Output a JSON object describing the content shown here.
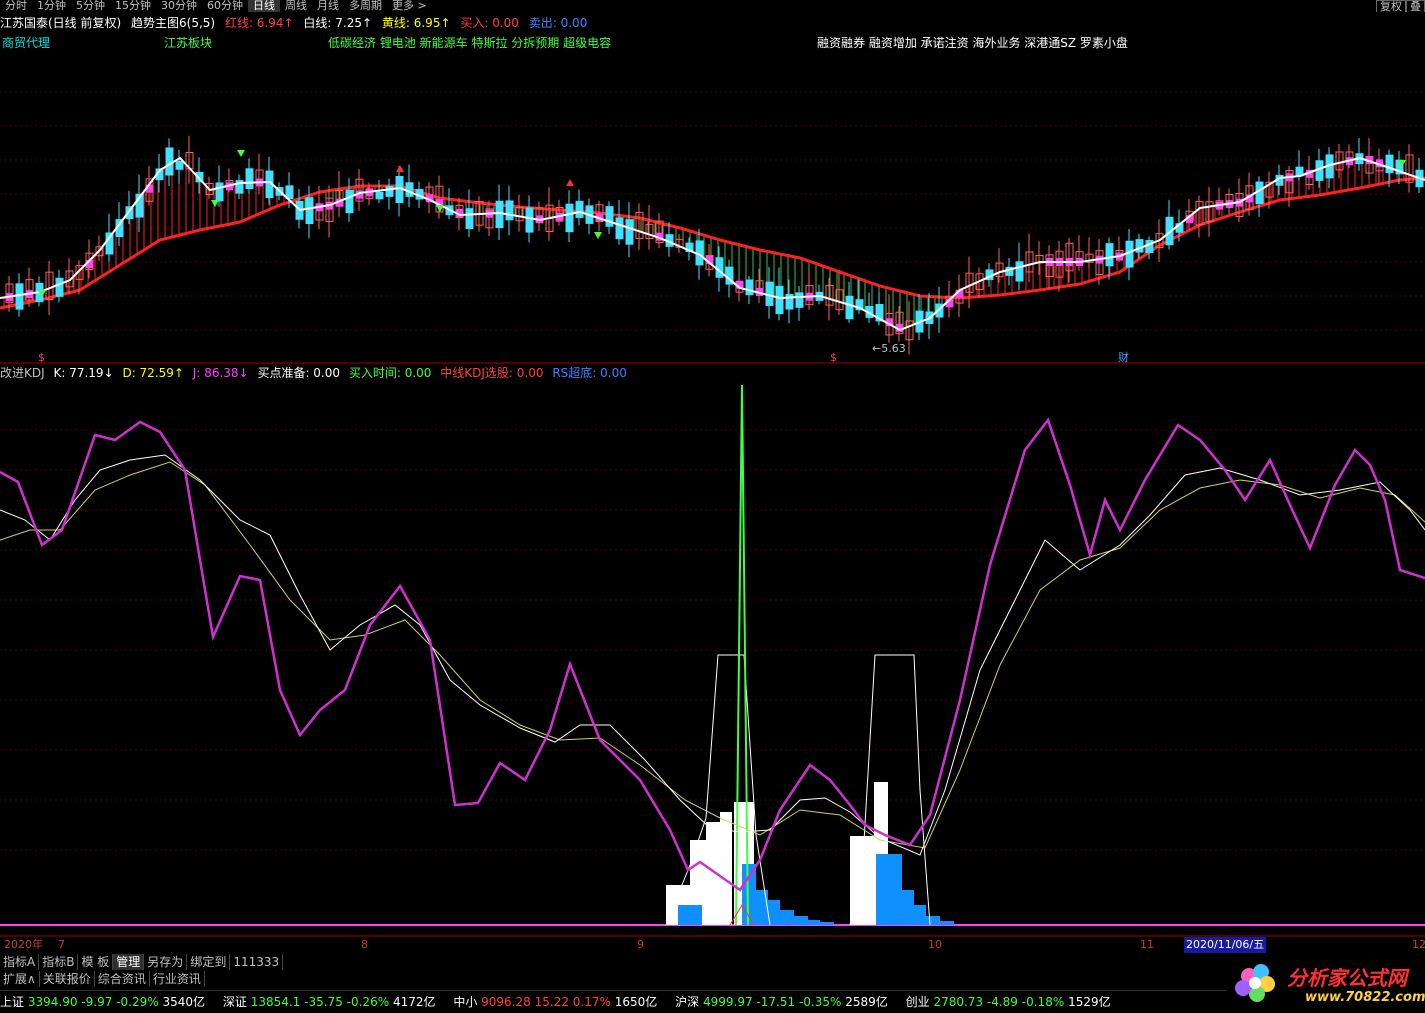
{
  "topbar": {
    "periods": [
      "分时",
      "1分钟",
      "5分钟",
      "15分钟",
      "30分钟",
      "60分钟",
      "日线",
      "周线",
      "月线",
      "多周期",
      "更多 >"
    ],
    "active": "日线",
    "right_button": "复权",
    "right_button2": "叠"
  },
  "title": {
    "stock": "江苏国泰(日线 前复权)",
    "indicator": "趋势主图6(5,5)",
    "red_label": "红线: 6.94↑",
    "white_label": "白线: 7.25↑",
    "yellow_label": "黄线: 6.95↑",
    "buy_label": "买入: 0.00",
    "sell_label": "卖出: 0.00"
  },
  "concepts": {
    "c1": "商贸代理",
    "c2": "江苏板块",
    "c3": "低碳经济 锂电池 新能源车 特斯拉 分拆预期 超级电容",
    "c4": "融资融券 融资增加 承诺注资 海外业务 深港通SZ 罗素小盘"
  },
  "main_chart": {
    "low_marker": "←5.63",
    "cai_marker": "财",
    "s1": "$",
    "s2": "$"
  },
  "kdj": {
    "name": "改进KDJ",
    "k": "K: 77.19↓",
    "d": "D: 72.59↑",
    "j": "J: 86.38↓",
    "prep": "买点准备: 0.00",
    "buytime": "买入时间: 0.00",
    "mid": "中线KDJ选股: 0.00",
    "rs": "RS超底: 0.00"
  },
  "axis": {
    "year": "2020年",
    "m7": "7",
    "m8": "8",
    "m9": "9",
    "m10": "10",
    "m11": "11",
    "date": "2020/11/06/五",
    "m12": "12"
  },
  "tabs1": [
    "指标A",
    "指标B",
    "模 板",
    "管理",
    "另存为",
    "绑定到",
    "111333"
  ],
  "tabs1_active": "管理",
  "tabs2": [
    "扩展∧",
    "关联报价",
    "综合资讯",
    "行业资讯"
  ],
  "indices": [
    {
      "name": "上证",
      "price": "3394.90",
      "chg": "-9.97",
      "pct": "-0.29%",
      "vol": "3540亿"
    },
    {
      "name": "深证",
      "price": "13854.1",
      "chg": "-35.75",
      "pct": "-0.26%",
      "vol": "4172亿"
    },
    {
      "name": "中小",
      "price": "9096.28",
      "chg": "15.22",
      "pct": "0.17%",
      "vol": "1650亿"
    },
    {
      "name": "沪深",
      "price": "4999.97",
      "chg": "-17.51",
      "pct": "-0.35%",
      "vol": "2589亿"
    },
    {
      "name": "创业",
      "price": "2780.73",
      "chg": "-4.89",
      "pct": "-0.18%",
      "vol": "1529亿"
    }
  ],
  "logo": {
    "text": "分析家公式网",
    "url": "www.70822.com"
  },
  "colors": {
    "up": "#ff4040",
    "down": "#00d000",
    "kline_up": "#ff40ff",
    "kline_dn": "#40e0ff",
    "red_line": "#ff2020",
    "white_line": "#ffffff"
  }
}
